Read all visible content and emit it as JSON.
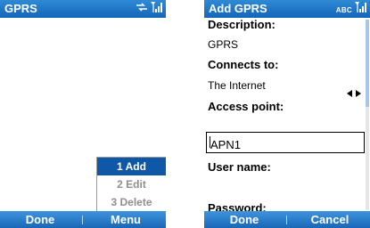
{
  "left": {
    "title": "GPRS",
    "menu": [
      {
        "label": "1 Add",
        "selected": true
      },
      {
        "label": "2 Edit",
        "selected": false
      },
      {
        "label": "3 Delete",
        "selected": false
      }
    ],
    "softkeys": {
      "left": "Done",
      "right": "Menu"
    },
    "status_icons": [
      "data-connection-icon",
      "signal-strength-icon"
    ]
  },
  "right": {
    "title": "Add GPRS",
    "input_mode": "ABC",
    "fields": {
      "description_label": "Description:",
      "description_value": "GPRS",
      "connects_to_label": "Connects to:",
      "connects_to_value": "The Internet",
      "access_point_label": "Access point:",
      "access_point_value": "APN1",
      "user_name_label": "User name:",
      "password_label": "Password:"
    },
    "softkeys": {
      "left": "Done",
      "right": "Cancel"
    },
    "status_icons": [
      "signal-strength-icon"
    ]
  },
  "colors": {
    "title_bar": "#1a6fc4",
    "selection": "#0f57a7"
  }
}
